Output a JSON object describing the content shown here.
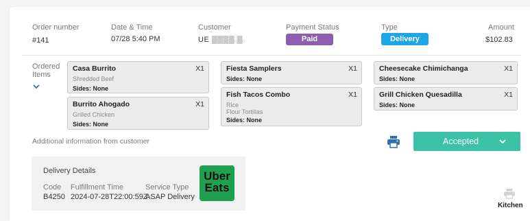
{
  "header": {
    "order_number_label": "Order number",
    "order_number": "#141",
    "datetime_label": "Date & Time",
    "datetime": "07/28 5:40 PM",
    "customer_label": "Customer",
    "customer": "UE ▒▒▒▒ ▒",
    "payment_label": "Payment Status",
    "payment": "Paid",
    "type_label": "Type",
    "type": "Delivery",
    "amount_label": "Amount",
    "amount": "$102.83"
  },
  "ordered_items_label_1": "Ordered",
  "ordered_items_label_2": "Items",
  "items": [
    {
      "name": "Casa Burrito",
      "qty": "X1",
      "mods": [
        "Shredded Beef"
      ],
      "sides": "Sides: None"
    },
    {
      "name": "Burrito Ahogado",
      "qty": "X1",
      "mods": [
        "Grilled Chicken"
      ],
      "sides": "Sides: None"
    },
    {
      "name": "Fiesta Samplers",
      "qty": "X1",
      "mods": [],
      "sides": "Sides: None"
    },
    {
      "name": "Fish Tacos Combo",
      "qty": "X1",
      "mods": [
        "Rice",
        "Flour Tortillas"
      ],
      "sides": "Sides: None"
    },
    {
      "name": "Cheesecake Chimichanga",
      "qty": "X1",
      "mods": [],
      "sides": "Sides: None"
    },
    {
      "name": "Grill Chicken Quesadilla",
      "qty": "X1",
      "mods": [],
      "sides": "Sides: None"
    }
  ],
  "additional_info_label": "Additional information from customer",
  "delivery": {
    "title": "Delivery Details",
    "code_label": "Code",
    "code": "B4250",
    "fulfillment_label": "Fulfillment Time",
    "fulfillment": "2024-07-28T22:00:59Z",
    "service_label": "Service Type",
    "service": "ASAP Delivery"
  },
  "logo_text_1": "Uber",
  "logo_text_2": "Eats",
  "status": "Accepted",
  "kitchen_label": "Kitchen",
  "colors": {
    "paid": "#8d5cb3",
    "delivery": "#1da6e6",
    "accepted": "#3cc2a7",
    "printer": "#2e6fb5",
    "uber_eats": "#1fa150"
  },
  "icons": {
    "expand": "chevron-down-icon",
    "print": "printer-icon",
    "status_dropdown": "chevron-down-icon",
    "kitchen": "printer-icon"
  }
}
